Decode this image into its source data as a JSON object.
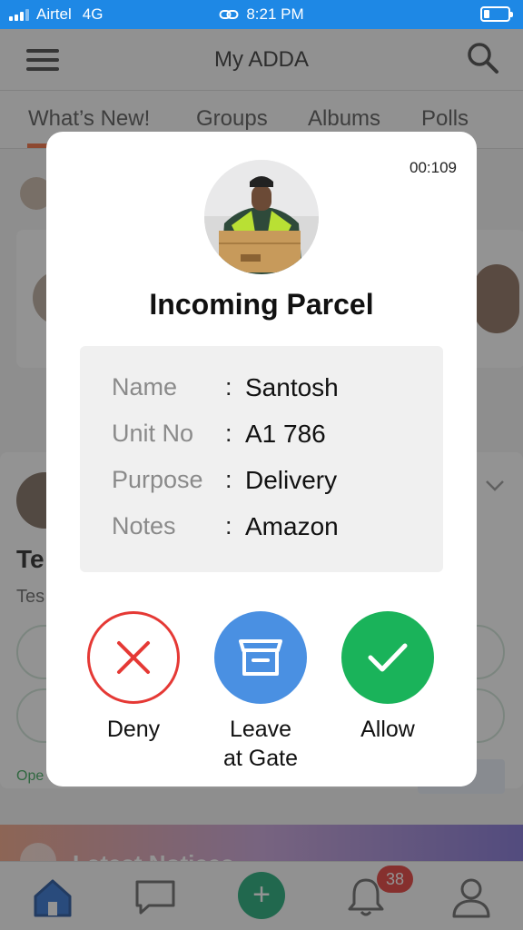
{
  "status_bar": {
    "carrier": "Airtel",
    "network": "4G",
    "time": "8:21 PM",
    "accent": "#1e88e5",
    "battery_level": 0.25
  },
  "app": {
    "title": "My ADDA",
    "tabs": [
      "What’s New!",
      "Groups",
      "Albums",
      "Polls"
    ],
    "active_tab": 0
  },
  "feed": {
    "partial_title": "Te",
    "partial_subtitle": "Tes",
    "partial_status": "Ope",
    "notice_text": "Latest Notices"
  },
  "bottom_nav": {
    "items": [
      "home-icon",
      "chat-icon",
      "plus-icon",
      "bell-icon",
      "profile-icon"
    ],
    "notification_count": "38"
  },
  "modal": {
    "timer": "00:109",
    "title": "Incoming Parcel",
    "details": [
      {
        "label": "Name",
        "value": "Santosh"
      },
      {
        "label": "Unit No",
        "value": "A1 786"
      },
      {
        "label": "Purpose",
        "value": "Delivery"
      },
      {
        "label": "Notes",
        "value": "Amazon"
      }
    ],
    "actions": {
      "deny": {
        "label": "Deny",
        "color": "#e53935"
      },
      "leave": {
        "label_line1": "Leave",
        "label_line2": "at Gate",
        "color": "#4a90e2"
      },
      "allow": {
        "label": "Allow",
        "color": "#1ab35a"
      }
    }
  }
}
